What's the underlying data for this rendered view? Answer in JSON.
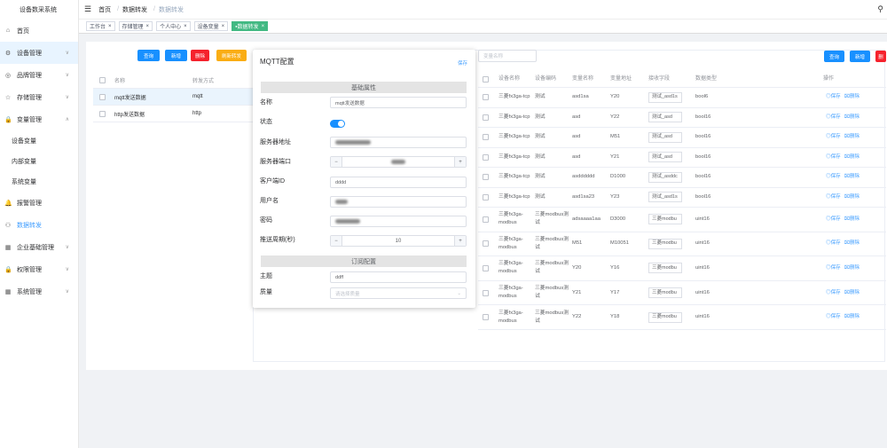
{
  "app": {
    "title": "设备数采系统"
  },
  "sidebar": {
    "items": [
      {
        "icon": "home-icon",
        "glyph": "⌂",
        "label": "首页"
      },
      {
        "icon": "gear-icon",
        "glyph": "⚙",
        "label": "设备管理"
      },
      {
        "icon": "globe-icon",
        "glyph": "◎",
        "label": "品牌管理"
      },
      {
        "icon": "star-icon",
        "glyph": "☆",
        "label": "存储管理"
      },
      {
        "icon": "lock-icon",
        "glyph": "🔒",
        "label": "变量管理"
      }
    ],
    "sub_items": [
      "设备变量",
      "内部变量",
      "系统变量"
    ],
    "items2": [
      {
        "icon": "bell-icon",
        "glyph": "🔔",
        "label": "报警管理"
      },
      {
        "icon": "share-icon",
        "glyph": "⚇",
        "label": "数据转发"
      },
      {
        "icon": "building-icon",
        "glyph": "▦",
        "label": "企业基础管理"
      },
      {
        "icon": "lock-icon",
        "glyph": "🔒",
        "label": "权限管理"
      },
      {
        "icon": "grid-icon",
        "glyph": "▦",
        "label": "系统管理"
      }
    ]
  },
  "header": {
    "breadcrumb": [
      "首页",
      "数据转发",
      "数据转发"
    ]
  },
  "tags": [
    {
      "label": "工作台",
      "active": false
    },
    {
      "label": "存储管理",
      "active": false
    },
    {
      "label": "个人中心",
      "active": false
    },
    {
      "label": "设备变量",
      "active": false
    },
    {
      "label": "数据转发",
      "active": true
    }
  ],
  "left_toolbar": {
    "query": "查询",
    "add": "新增",
    "delete": "删除",
    "refresh": "刷新转发"
  },
  "left_table": {
    "headers": [
      "名称",
      "转发方式"
    ],
    "rows": [
      [
        "mqtt发送数据",
        "mqtt"
      ],
      [
        "http发送数据",
        "http"
      ]
    ]
  },
  "right_search": {
    "placeholder": "变量名称"
  },
  "right_toolbar": {
    "query": "查询",
    "add": "新增",
    "delete": "删"
  },
  "right_table": {
    "headers": [
      "设备名称",
      "设备编码",
      "变量名称",
      "变量地址",
      "接收字段",
      "数据类型",
      "操作"
    ],
    "rows": [
      {
        "device": "三菱fx3ga-tcp",
        "code": "测试",
        "name": "asd1sa",
        "addr": "Y20",
        "field": "测试_asd1s",
        "type": "bool6"
      },
      {
        "device": "三菱fx3ga-tcp",
        "code": "测试",
        "name": "asd",
        "addr": "Y22",
        "field": "测试_asd",
        "type": "bool16"
      },
      {
        "device": "三菱fx3ga-tcp",
        "code": "测试",
        "name": "asd",
        "addr": "M51",
        "field": "测试_asd",
        "type": "bool16"
      },
      {
        "device": "三菱fx3ga-tcp",
        "code": "测试",
        "name": "asd",
        "addr": "Y21",
        "field": "测试_asd",
        "type": "bool16"
      },
      {
        "device": "三菱fx3ga-tcp",
        "code": "测试",
        "name": "asdddddd",
        "addr": "D1000",
        "field": "测试_asddc",
        "type": "bool16"
      },
      {
        "device": "三菱fx3ga-tcp",
        "code": "测试",
        "name": "asd1sa23",
        "addr": "Y23",
        "field": "测试_asd1s",
        "type": "bool16"
      },
      {
        "device": "三菱fx3ga-modbus",
        "code": "三菱modbus测试",
        "name": "adsaaaa1aa",
        "addr": "D3000",
        "field": "三菱modbu",
        "type": "uint16"
      },
      {
        "device": "三菱fx3ga-modbus",
        "code": "三菱modbus测试",
        "name": "M51",
        "addr": "M10051",
        "field": "三菱modbu",
        "type": "uint16"
      },
      {
        "device": "三菱fx3ga-modbus",
        "code": "三菱modbus测试",
        "name": "Y20",
        "addr": "Y16",
        "field": "三菱modbu",
        "type": "uint16"
      },
      {
        "device": "三菱fx3ga-modbus",
        "code": "三菱modbus测试",
        "name": "Y21",
        "addr": "Y17",
        "field": "三菱modbu",
        "type": "uint16"
      },
      {
        "device": "三菱fx3ga-modbus",
        "code": "三菱modbus测试",
        "name": "Y22",
        "addr": "Y18",
        "field": "三菱modbu",
        "type": "uint16"
      }
    ],
    "op_save": "保存",
    "op_delete": "删除"
  },
  "modal": {
    "title": "MQTT配置",
    "save": "保存",
    "section_basic": "基础属性",
    "section_sub": "订阅配置",
    "labels": {
      "name": "名称",
      "status": "状态",
      "server": "服务器地址",
      "port": "服务器端口",
      "client": "客户端ID",
      "user": "用户名",
      "pwd": "密码",
      "period": "推送周期(秒)",
      "topic": "主题",
      "qos": "质量"
    },
    "values": {
      "name": "mqtt发送数据",
      "client": "dddd",
      "period": "10",
      "topic": "ddff",
      "qos_placeholder": "请选择质量",
      "status_on": true
    }
  }
}
